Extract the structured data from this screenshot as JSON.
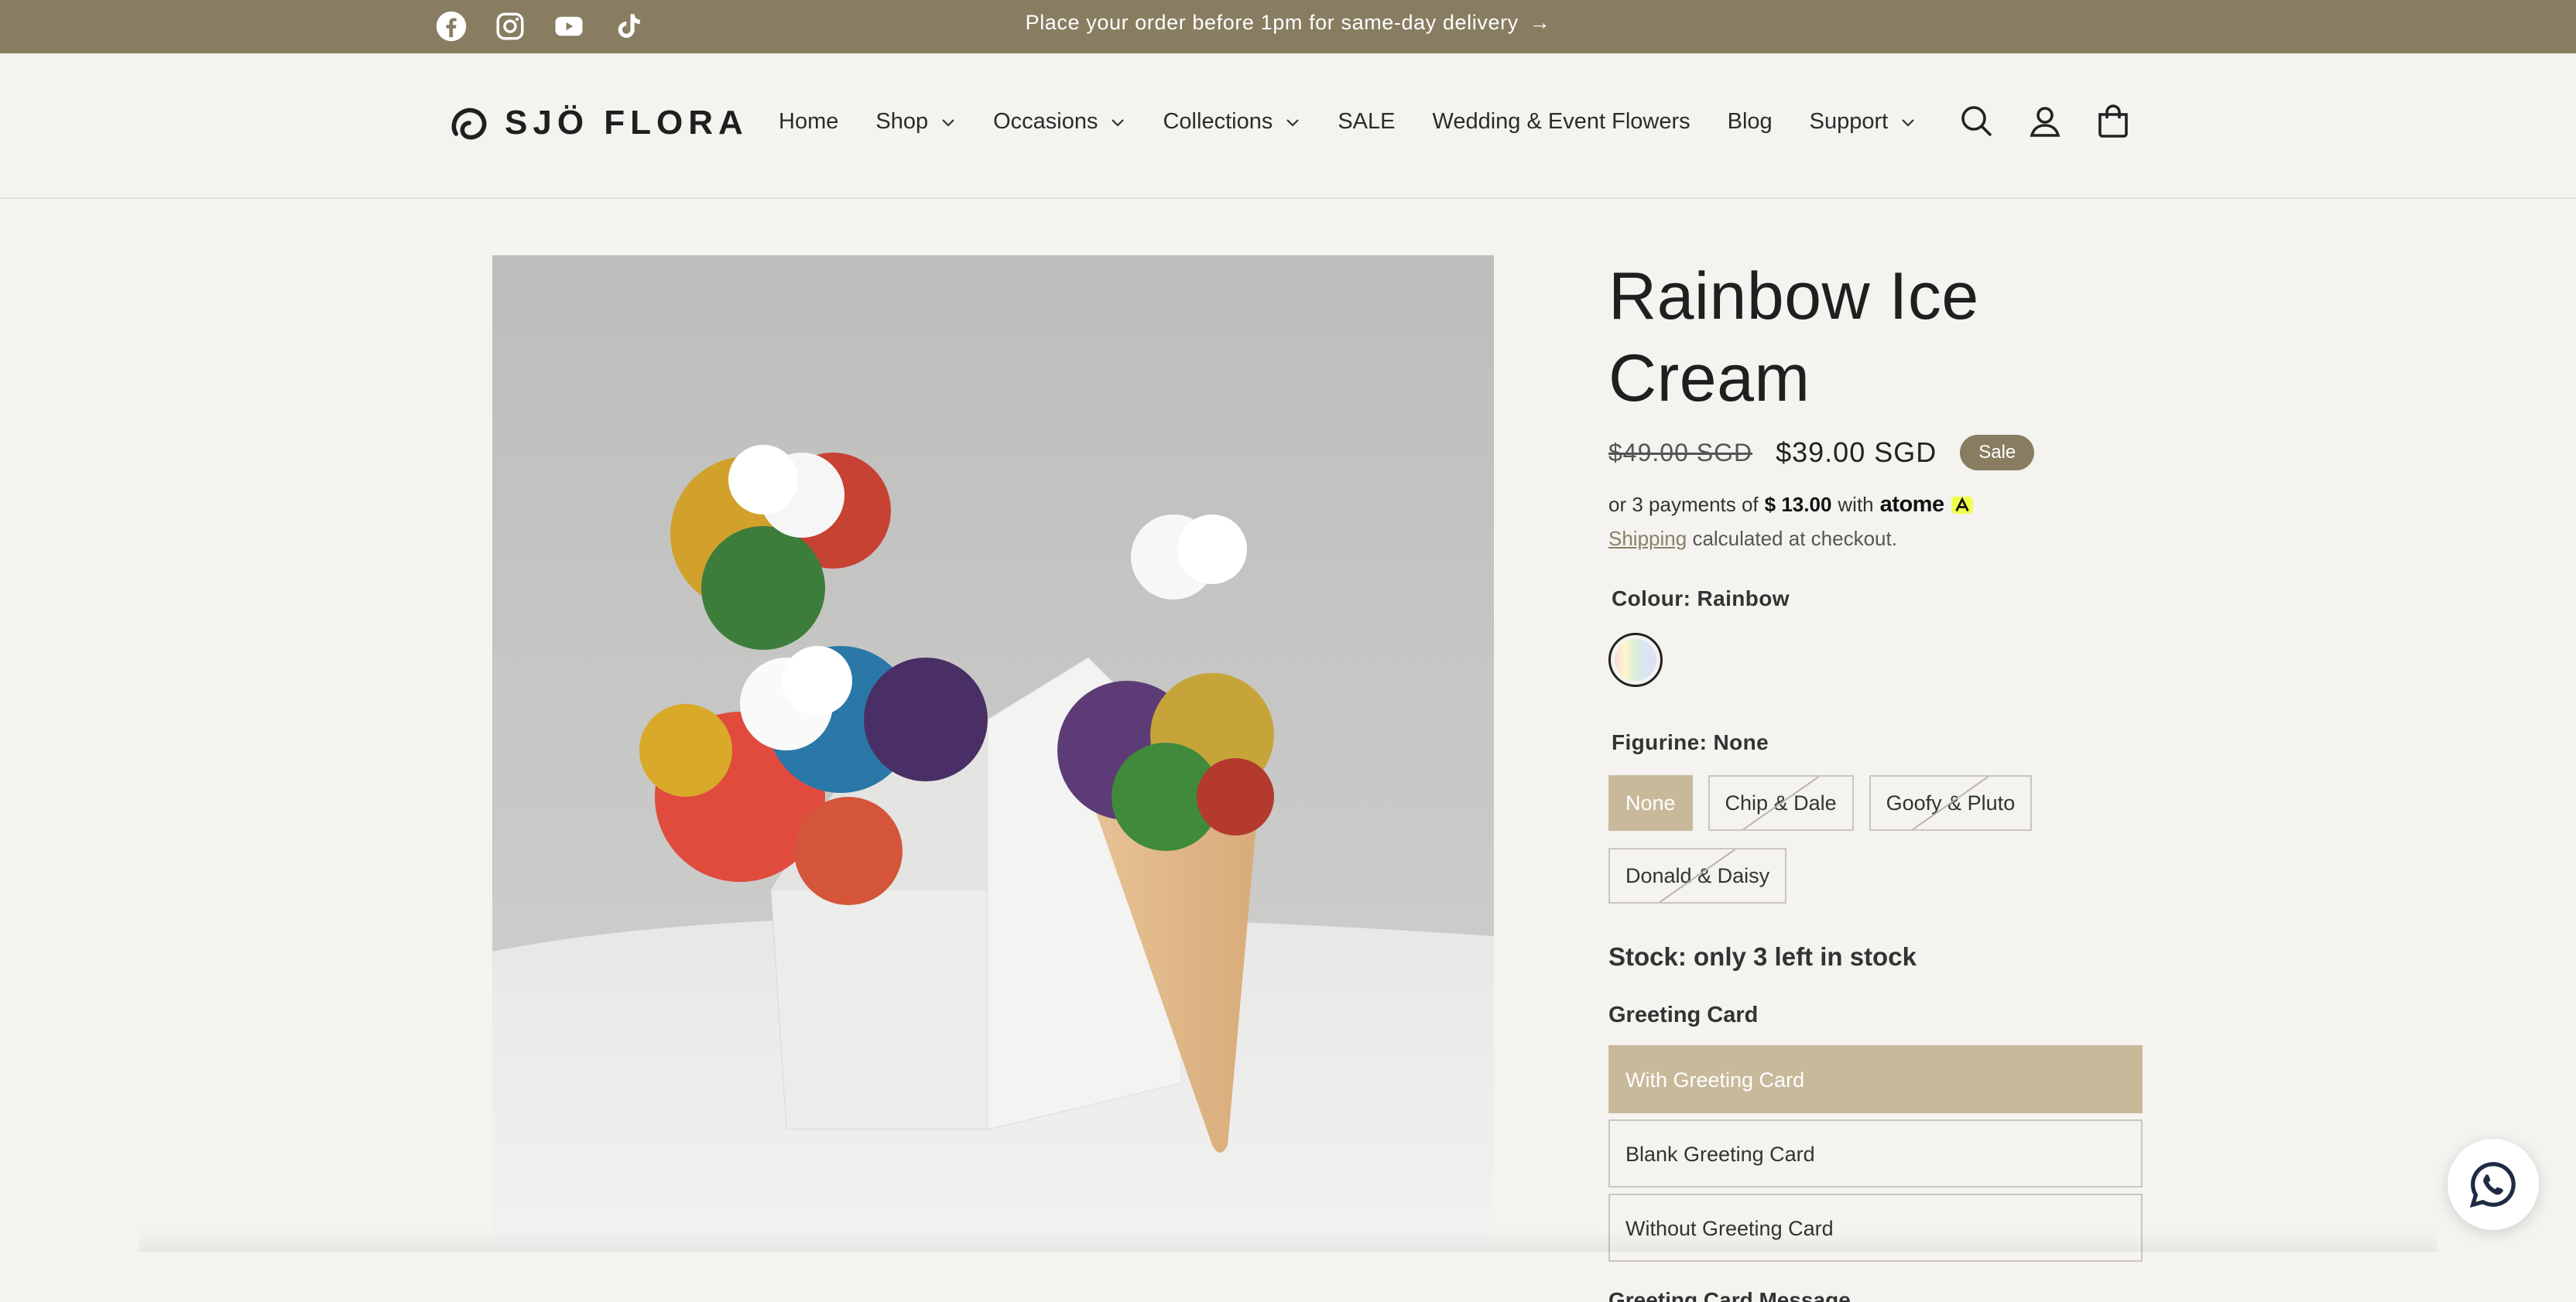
{
  "announcement": {
    "text": "Place your order before 1pm for same-day delivery",
    "arrow": "→"
  },
  "social_icons": [
    "facebook-icon",
    "instagram-icon",
    "youtube-icon",
    "tiktok-icon"
  ],
  "logo": {
    "text": "SJÖ FLORA"
  },
  "nav": {
    "items": [
      {
        "label": "Home",
        "dropdown": false
      },
      {
        "label": "Shop",
        "dropdown": true
      },
      {
        "label": "Occasions",
        "dropdown": true
      },
      {
        "label": "Collections",
        "dropdown": true
      },
      {
        "label": "SALE",
        "dropdown": false
      },
      {
        "label": "Wedding & Event Flowers",
        "dropdown": false
      },
      {
        "label": "Blog",
        "dropdown": false
      },
      {
        "label": "Support",
        "dropdown": true
      }
    ]
  },
  "header_icons": [
    "search-icon",
    "account-icon",
    "cart-icon"
  ],
  "product": {
    "title": "Rainbow Ice Cream",
    "price_old": "$49.00 SGD",
    "price_new": "$39.00 SGD",
    "sale_badge": "Sale",
    "installments": {
      "prefix": "or 3 payments of",
      "amount": "$ 13.00",
      "with": "with",
      "brand": "atome"
    },
    "shipping": {
      "link": "Shipping",
      "text": "calculated at checkout."
    },
    "colour_label": "Colour: Rainbow",
    "figurine_label": "Figurine: None",
    "figurines": [
      {
        "label": "None",
        "selected": true,
        "disabled": false
      },
      {
        "label": "Chip & Dale",
        "selected": false,
        "disabled": true
      },
      {
        "label": "Goofy & Pluto",
        "selected": false,
        "disabled": true
      },
      {
        "label": "Donald & Daisy",
        "selected": false,
        "disabled": true
      }
    ],
    "stock": "Stock: only 3 left in stock",
    "greeting_label": "Greeting Card",
    "greeting_options": [
      {
        "label": "With Greeting Card",
        "selected": true
      },
      {
        "label": "Blank Greeting Card",
        "selected": false
      },
      {
        "label": "Without Greeting Card",
        "selected": false
      }
    ],
    "greeting_message_label": "Greeting Card Message"
  },
  "colors": {
    "brand": "#887d61",
    "selected": "#c8b99b",
    "background": "#f4f3ef"
  }
}
